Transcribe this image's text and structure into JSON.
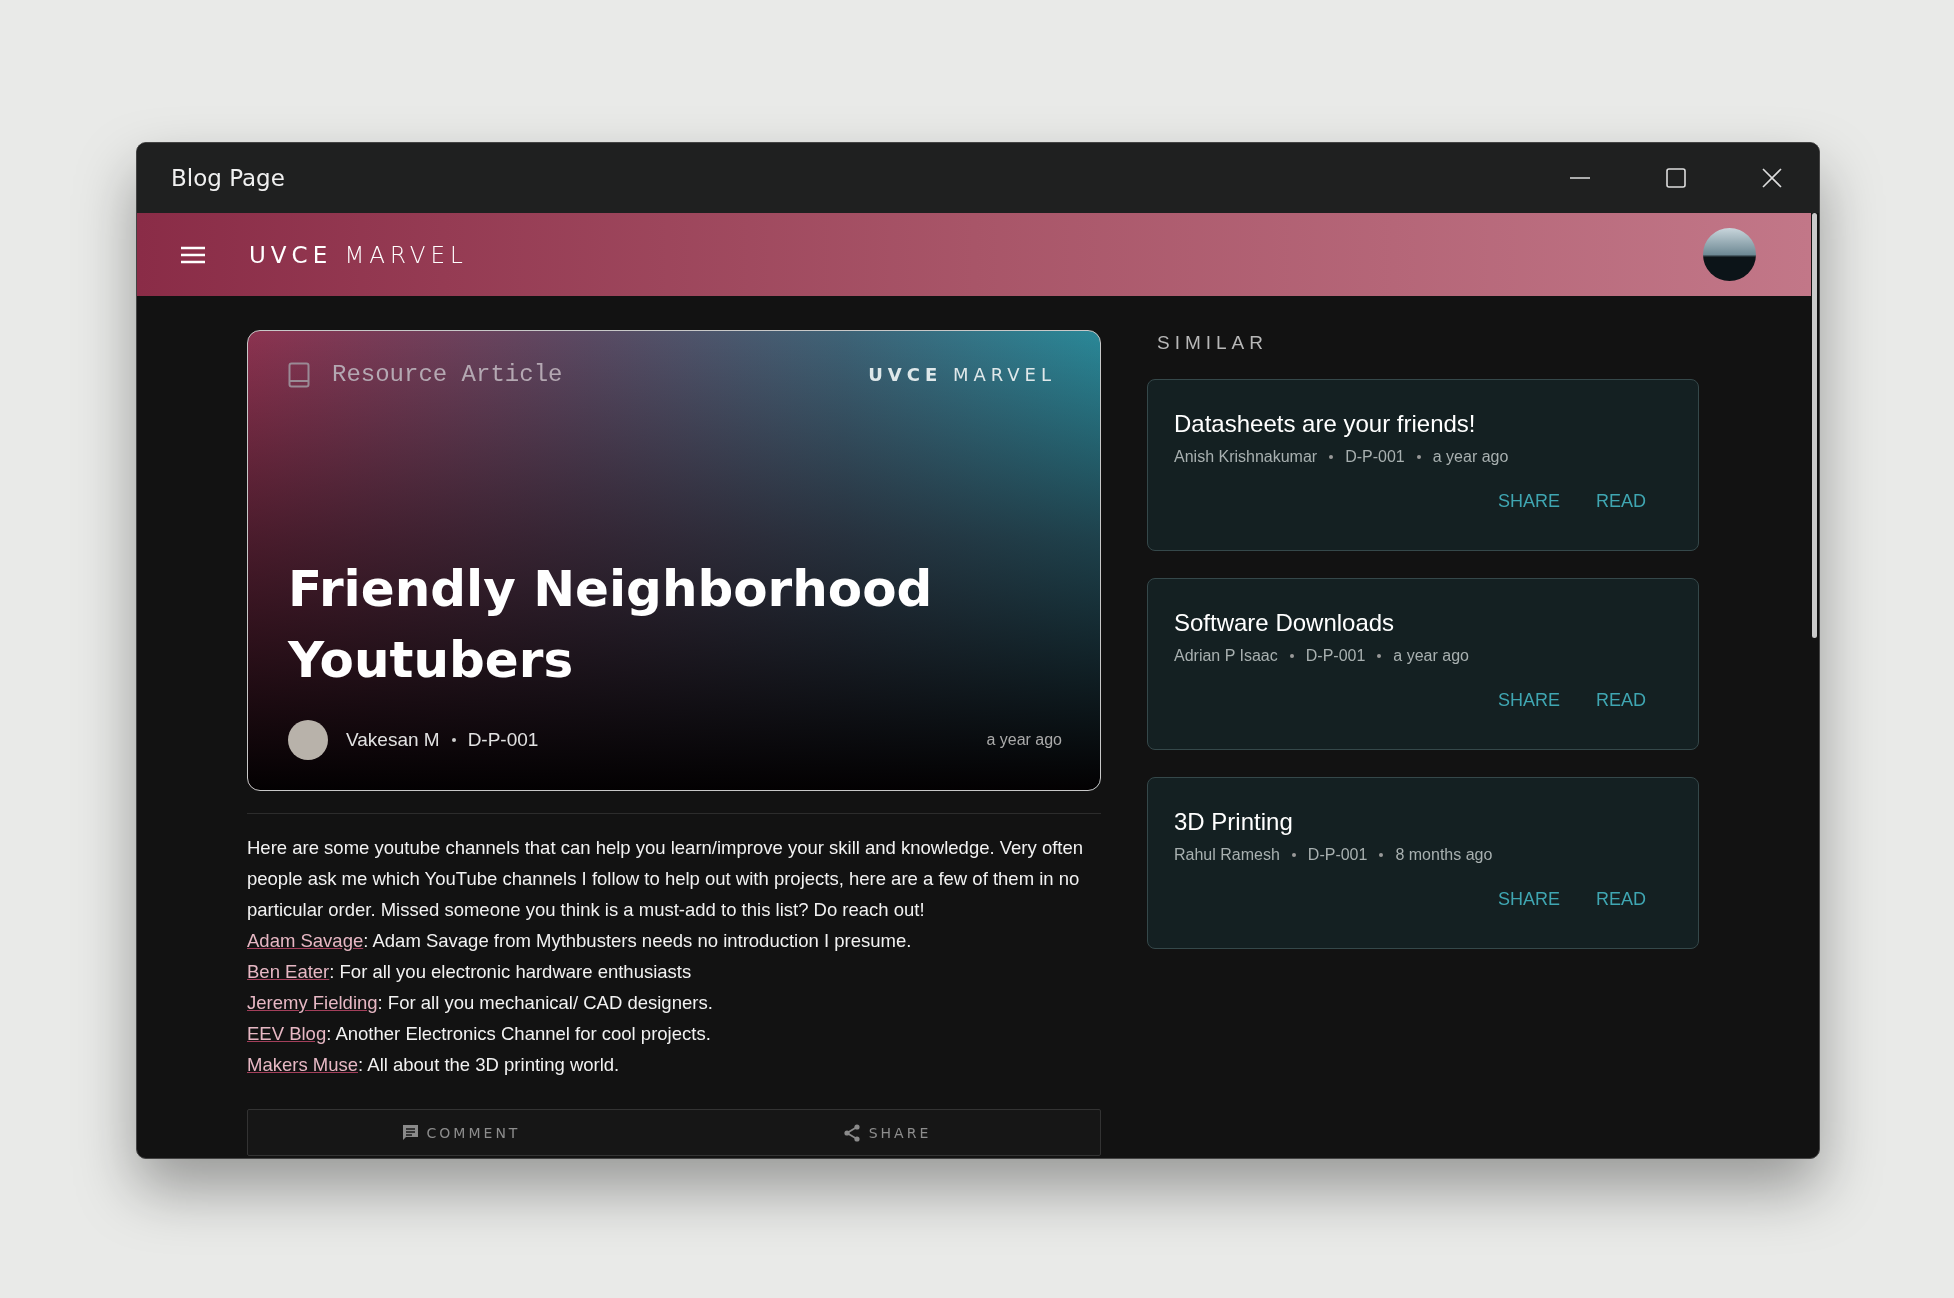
{
  "window": {
    "title": "Blog Page"
  },
  "header": {
    "logo": "**UVCE** MARVEL"
  },
  "hero": {
    "category": "Resource Article",
    "logo": "**UVCE** MARVEL",
    "title": "Friendly Neighborhood Youtubers",
    "author": "Vakesan M",
    "code": "D-P-001",
    "time": "a year ago"
  },
  "article": {
    "intro": "Here are some youtube channels that can help you learn/improve your skill and knowledge. Very often people ask me which YouTube channels I follow to help out with projects, here are a few of them in no particular order. Missed someone you think is a must-add to this list? Do reach out!",
    "links": [
      {
        "name": "Adam Savage",
        "description": ": Adam Savage from Mythbusters needs no introduction I presume."
      },
      {
        "name": "Ben Eater",
        "description": ": For all you electronic hardware enthusiasts"
      },
      {
        "name": "Jeremy Fielding",
        "description": ": For all you mechanical/ CAD designers."
      },
      {
        "name": "EEV Blog",
        "description": ": Another Electronics Channel for cool projects."
      },
      {
        "name": "Makers Muse",
        "description": ": All about the 3D printing world."
      }
    ]
  },
  "actions": [
    {
      "kind": "comment",
      "label": "COMMENT"
    },
    {
      "kind": "share",
      "label": "SHARE"
    }
  ],
  "similar": {
    "heading": "SIMILAR",
    "posts": [
      {
        "title": "Datasheets are your friends!",
        "author": "Anish Krishnakumar",
        "code": "D-P-001",
        "time": "a year ago",
        "buttons": [
          "SHARE",
          "READ"
        ]
      },
      {
        "title": "Software Downloads",
        "author": "Adrian P Isaac",
        "code": "D-P-001",
        "time": "a year ago",
        "buttons": [
          "SHARE",
          "READ"
        ]
      },
      {
        "title": "3D Printing",
        "author": "Rahul Ramesh",
        "code": "D-P-001",
        "time": "8 months ago",
        "buttons": [
          "SHARE",
          "READ"
        ]
      }
    ]
  }
}
